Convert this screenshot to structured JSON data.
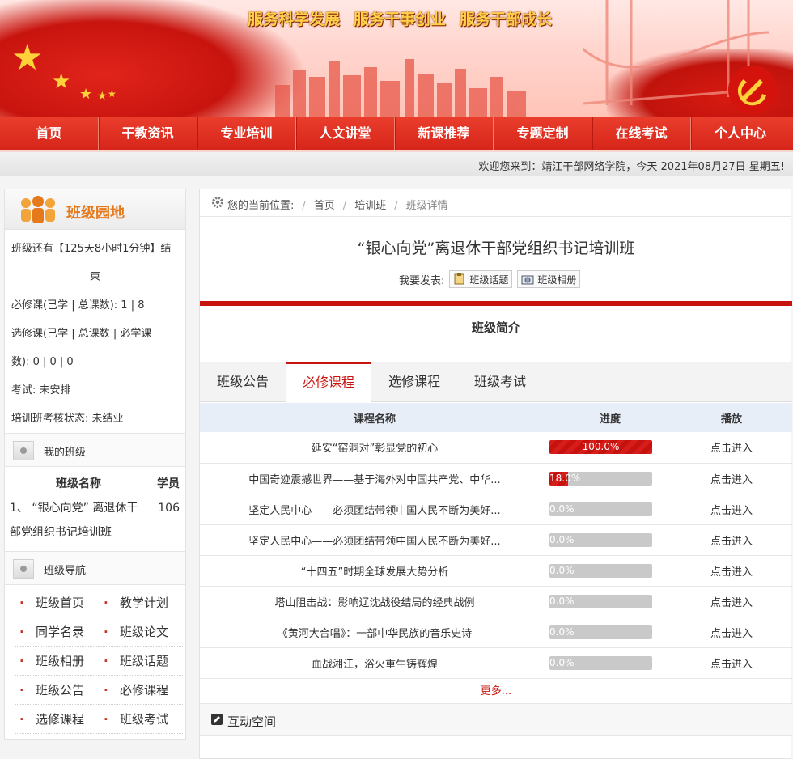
{
  "banner": {
    "slogans": [
      "服务科学发展",
      "服务干事创业",
      "服务干部成长"
    ]
  },
  "nav": {
    "items": [
      "首页",
      "干教资讯",
      "专业培训",
      "人文讲堂",
      "新课推荐",
      "专题定制",
      "在线考试",
      "个人中心"
    ]
  },
  "welcome": {
    "text": "欢迎您来到：靖江干部网络学院，今天 2021年08月27日 星期五!"
  },
  "sidebar": {
    "title": "班级园地",
    "remaining_line1": "班级还有【125天8小时1分钟】结",
    "remaining_line2": "束",
    "required_line": "必修课(已学 | 总课数): 1 | 8",
    "elective_line1": "选修课(已学 | 总课数 | 必学课",
    "elective_line2": "数): 0 | 0 | 0",
    "exam_line": "考试:   未安排",
    "status_line": "培训班考核状态:   未结业",
    "my_class": {
      "heading": "我的班级",
      "col_name": "班级名称",
      "col_students": "学员",
      "row_name_line1": "1、 “银心向党” 离退休干",
      "row_name_line2": "部党组织书记培训班",
      "row_students": "106"
    },
    "class_nav": {
      "heading": "班级导航",
      "links": [
        "班级首页",
        "教学计划",
        "同学名录",
        "班级论文",
        "班级相册",
        "班级话题",
        "班级公告",
        "必修课程",
        "选修课程",
        "班级考试"
      ]
    }
  },
  "main": {
    "breadcrumb": {
      "prefix": "您的当前位置:",
      "home": "首页",
      "training": "培训班",
      "current": "班级详情"
    },
    "class_title": "“银心向党”离退休干部党组织书记培训班",
    "post_label": "我要发表:",
    "post_topic": "班级话题",
    "post_album": "班级相册",
    "intro_heading": "班级简介",
    "tabs": [
      "班级公告",
      "必修课程",
      "选修课程",
      "班级考试"
    ],
    "active_tab": 1,
    "table": {
      "col_name": "课程名称",
      "col_progress": "进度",
      "col_play": "播放",
      "rows": [
        {
          "name": "延安“窑洞对”彰显党的初心",
          "progress": 100.0,
          "progress_label": "100.0%",
          "play": "点击进入"
        },
        {
          "name": "中国奇迹震撼世界——基于海外对中国共产党、中华...",
          "progress": 18.0,
          "progress_label": "18.0%",
          "play": "点击进入"
        },
        {
          "name": "坚定人民中心——必须团结带领中国人民不断为美好...",
          "progress": 0.0,
          "progress_label": "0.0%",
          "play": "点击进入"
        },
        {
          "name": "坚定人民中心——必须团结带领中国人民不断为美好...",
          "progress": 0.0,
          "progress_label": "0.0%",
          "play": "点击进入"
        },
        {
          "name": "“十四五”时期全球发展大势分析",
          "progress": 0.0,
          "progress_label": "0.0%",
          "play": "点击进入"
        },
        {
          "name": "塔山阻击战：影响辽沈战役结局的经典战例",
          "progress": 0.0,
          "progress_label": "0.0%",
          "play": "点击进入"
        },
        {
          "name": "《黄河大合唱》：一部中华民族的音乐史诗",
          "progress": 0.0,
          "progress_label": "0.0%",
          "play": "点击进入"
        },
        {
          "name": "血战湘江，浴火重生铸辉煌",
          "progress": 0.0,
          "progress_label": "0.0%",
          "play": "点击进入"
        }
      ]
    },
    "more_link": "更多...",
    "interact_heading": "互动空间"
  },
  "colors": {
    "primary_red": "#c8140e",
    "nav_red": "#e33324",
    "accent_orange": "#e5791c",
    "slogan_gold": "#ffd24a"
  }
}
